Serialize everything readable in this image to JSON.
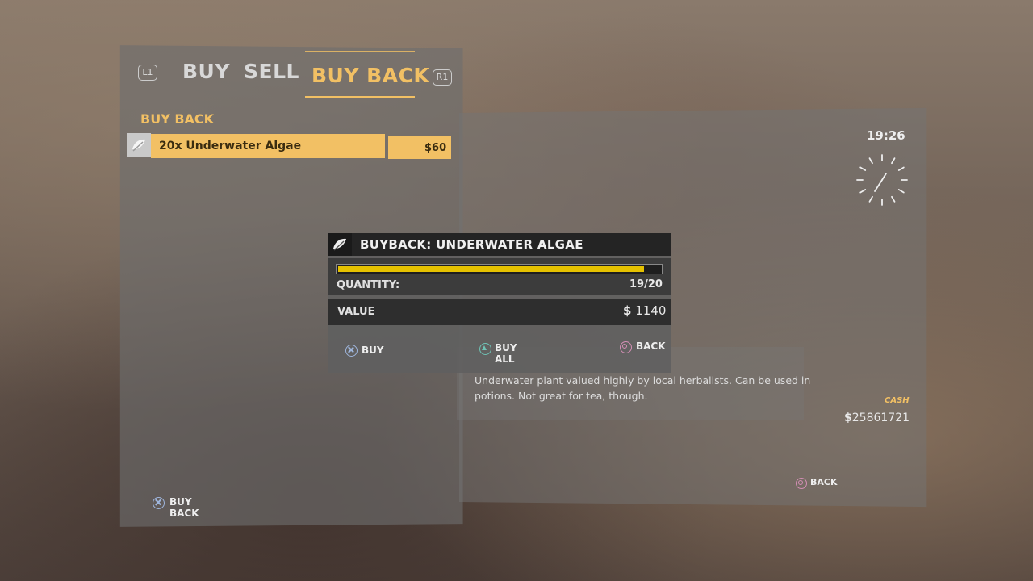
{
  "tabs": {
    "left_badge": "L1",
    "right_badge": "R1",
    "items": [
      {
        "label": "BUY"
      },
      {
        "label": "SELL"
      },
      {
        "label": "BUY BACK",
        "active": true
      }
    ]
  },
  "section_title": "BUY BACK",
  "list": {
    "items": [
      {
        "name": "20x Underwater Algae",
        "price": "$60",
        "icon": "leaf-icon"
      }
    ]
  },
  "clock": {
    "time": "19:26"
  },
  "dialog": {
    "title": "BUYBACK: UNDERWATER ALGAE",
    "icon": "leaf-icon",
    "quantity_label": "QUANTITY:",
    "quantity_value": "19/20",
    "quantity_fraction": 0.95,
    "value_label": "VALUE",
    "value_currency": "$",
    "value_amount": "1140",
    "buttons": {
      "buy": "BUY",
      "buy_all": "BUY ALL",
      "back": "BACK"
    }
  },
  "description": "Underwater plant valued highly by local herbalists. Can be used in potions. Not great for tea, though.",
  "cash": {
    "label": "CASH",
    "currency": "$",
    "amount": "25861721"
  },
  "footer": {
    "left_button": "BUY BACK",
    "right_button": "BACK"
  },
  "colors": {
    "accent": "#f2c064",
    "bar_fill": "#e5c100",
    "cross": "#9fb6dd",
    "circle": "#d58fb6",
    "triangle": "#6fc3b6"
  }
}
